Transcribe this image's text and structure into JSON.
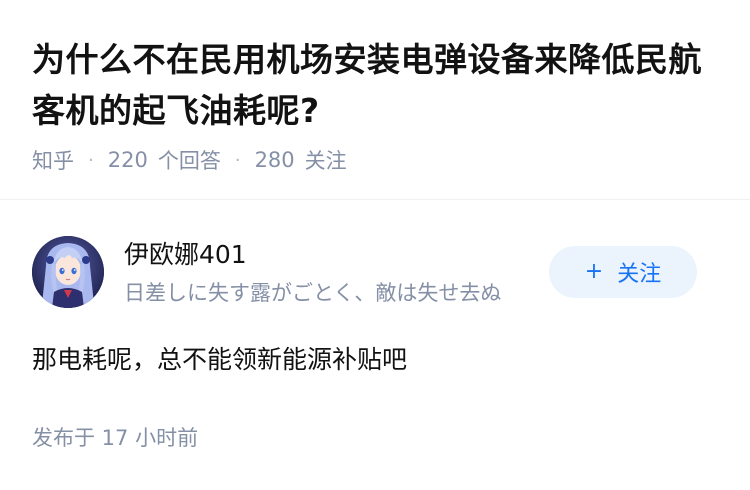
{
  "question": {
    "title": "为什么不在民用机场安装电弹设备来降低民航客机的起飞油耗呢?",
    "source": "知乎",
    "separator": "·",
    "answer_count": "220",
    "answer_label": "个回答",
    "follower_count": "280",
    "follower_label": "关注"
  },
  "answer": {
    "author": {
      "name": "伊欧娜401",
      "bio": "日差しに失す露がごとく、敵は失せ去ぬ",
      "avatar_icon": "anime-avatar-icon"
    },
    "follow_button": {
      "icon": "+",
      "label": "关注"
    },
    "content": "那电耗呢，总不能领新能源补贴吧",
    "published": "发布于  17 小时前"
  },
  "colors": {
    "title": "#121212",
    "meta": "#8590a6",
    "accent": "#1772f6",
    "follow_bg": "#ebf4fc",
    "divider": "#f0f1f3"
  }
}
